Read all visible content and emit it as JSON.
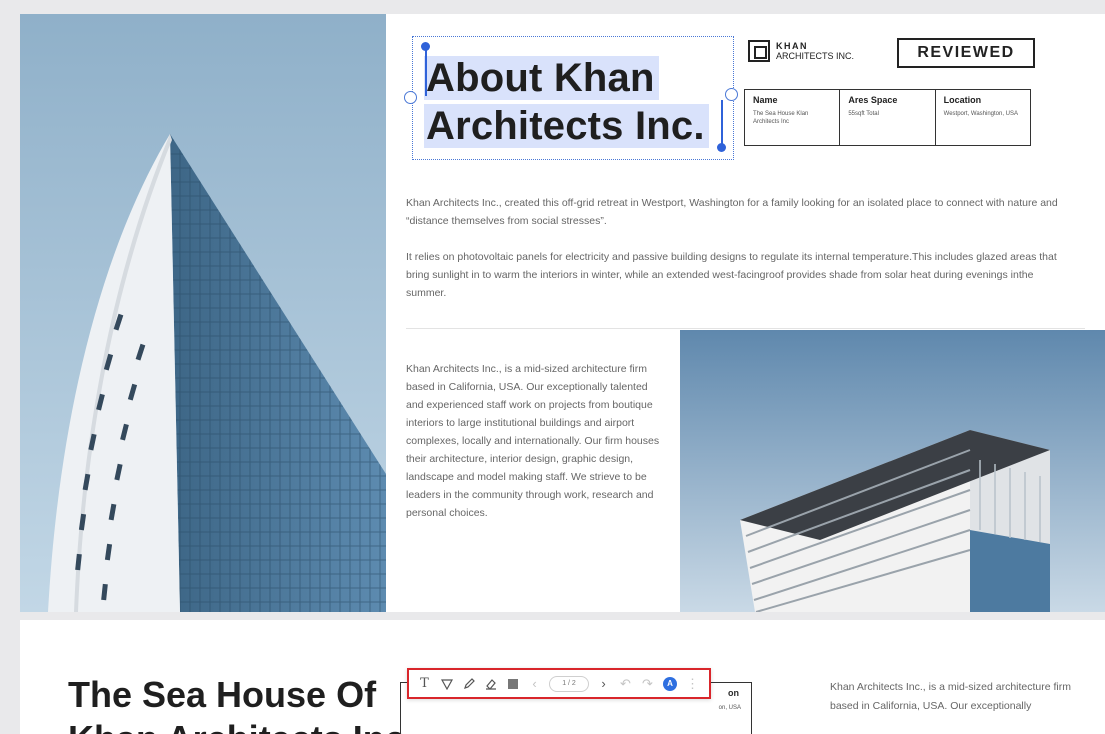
{
  "page1": {
    "title_line1": "About Khan",
    "title_line2": "Architects Inc.",
    "logo": {
      "name": "KHAN",
      "sub": "ARCHITECTS INC."
    },
    "stamp": "REVIEWED",
    "info": [
      {
        "header": "Name",
        "value": "The Sea House Klan Architects Inc"
      },
      {
        "header": "Ares Space",
        "value": "55sqft Total"
      },
      {
        "header": "Location",
        "value": "Westport, Washington, USA"
      }
    ],
    "paragraph1": "Khan Architects Inc., created this off-grid retreat in Westport, Washington for a family looking for an isolated place to connect with nature and “distance themselves from social stresses”.",
    "paragraph2": "It relies on photovoltaic panels for electricity and passive building designs to regulate its internal temperature.This includes glazed areas that bring sunlight in to warm the interiors in winter, while an extended west-facingroof provides shade from solar heat during evenings inthe summer.",
    "paragraph3": "Khan Architects Inc., is a mid-sized architecture firm based in California, USA. Our exceptionally talented and experienced staff work on projects from boutique interiors to large institutional buildings and airport complexes, locally and internationally. Our firm houses their architecture, interior design, graphic design, landscape and model making staff. We strieve to be leaders in the community through work, research and personal choices."
  },
  "page2": {
    "title_line1": "The Sea House Of",
    "title_line2": "Khan Architects Inc.",
    "table_header": "on",
    "table_value": "on, USA",
    "paragraph": "Khan Architects Inc., is a mid-sized architecture firm based in California, USA. Our exceptionally"
  },
  "toolbar": {
    "icons": [
      "text-tool-icon",
      "highlighter-icon",
      "pen-icon",
      "eraser-icon",
      "color-swatch-icon",
      "prev-page-icon",
      "next-page-icon",
      "undo-icon",
      "redo-icon",
      "ai-assistant-icon",
      "more-icon"
    ],
    "page_indicator": "1 / 2",
    "ai_label": "A"
  },
  "colors": {
    "selection": "#2f62d9",
    "highlight": "#d9e2fb",
    "toolbar_border": "#d9262b",
    "sky": "#9fbdd6"
  }
}
